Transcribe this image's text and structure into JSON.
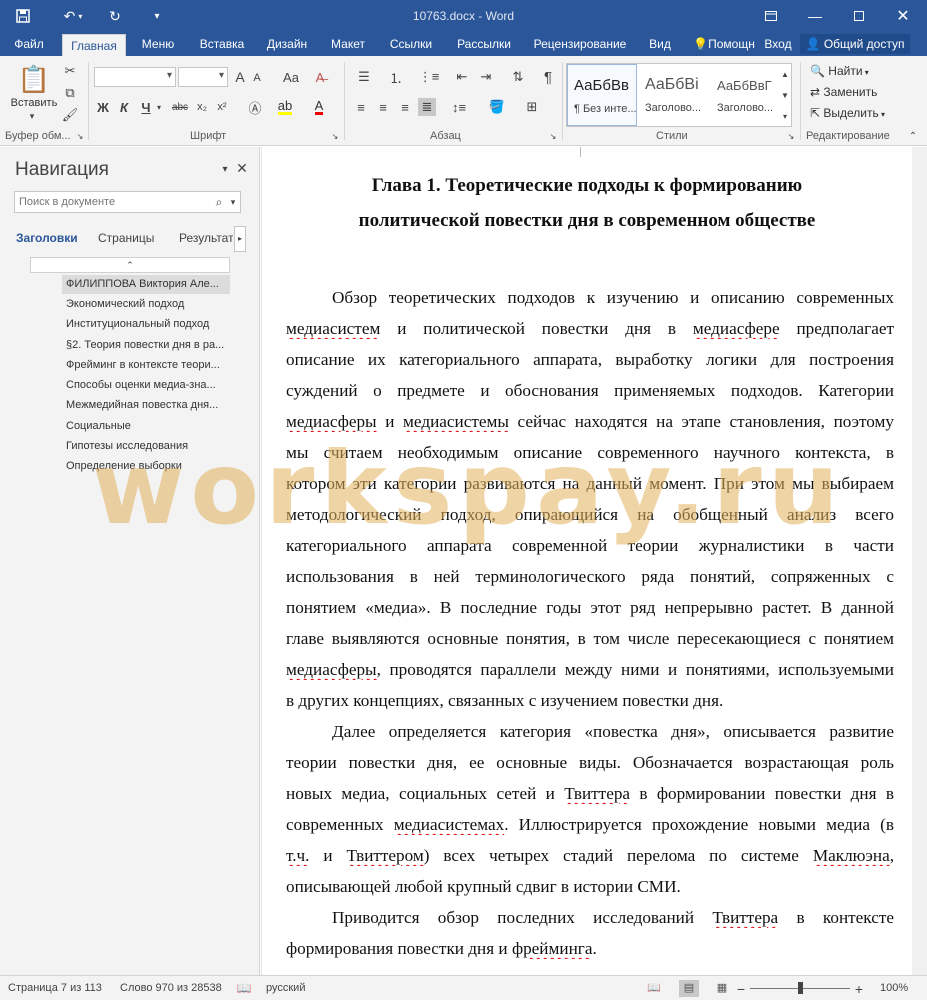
{
  "window": {
    "title": "10763.docx - Word",
    "icons": [
      "save-icon",
      "undo-icon",
      "redo-icon",
      "customize-icon",
      "ribbon-options-icon",
      "minimize-icon",
      "maximize-icon",
      "close-icon"
    ]
  },
  "tabs": {
    "file": "Файл",
    "home": "Главная",
    "menu": "Меню",
    "insert": "Вставка",
    "design": "Дизайн",
    "layout": "Макет",
    "references": "Ссылки",
    "mailings": "Рассылки",
    "review": "Рецензирование",
    "view": "Вид",
    "help": "Помощн",
    "signin": "Вход",
    "share": "Общий доступ"
  },
  "ribbon": {
    "paste_label": "Вставить",
    "clipboard_label": "Буфер обм...",
    "font_label": "Шрифт",
    "paragraph_label": "Абзац",
    "styles_label": "Стили",
    "editing_label": "Редактирование",
    "bold": "Ж",
    "italic": "К",
    "underline": "Ч",
    "strike": "abc",
    "subscript": "x₂",
    "superscript": "x²",
    "grow_font": "A",
    "shrink_font": "A",
    "change_case": "Aa",
    "styles": [
      {
        "sample": "АаБбВв",
        "name": "¶ Без инте..."
      },
      {
        "sample": "АаБбВі",
        "name": "Заголово..."
      },
      {
        "sample": "АаБбВвГ",
        "name": "Заголово..."
      }
    ],
    "find": "Найти",
    "replace": "Заменить",
    "select": "Выделить"
  },
  "nav": {
    "title": "Навигация",
    "search_placeholder": "Поиск в документе",
    "tab_headings": "Заголовки",
    "tab_pages": "Страницы",
    "tab_results": "Результаты",
    "headings": [
      "ФИЛИППОВА Виктория Але...",
      "Экономический подход",
      "Институциональный подход",
      "§2. Теория повестки дня в ра...",
      "Фрейминг в контексте теори...",
      "Способы оценки медиа-зна...",
      "Межмедийная повестка дня...",
      "Социальные",
      "Гипотезы исследования",
      "Определение выборки"
    ]
  },
  "document": {
    "heading_line1": "Глава 1. Теоретические подходы к формированию",
    "heading_line2": "политической повестки дня в современном обществе",
    "watermark": "workspay.ru"
  },
  "status": {
    "page": "Страница 7 из 113",
    "words": "Слово 970 из 28538",
    "language": "русский",
    "zoom": "100%",
    "zoom_value_percent": 100
  }
}
